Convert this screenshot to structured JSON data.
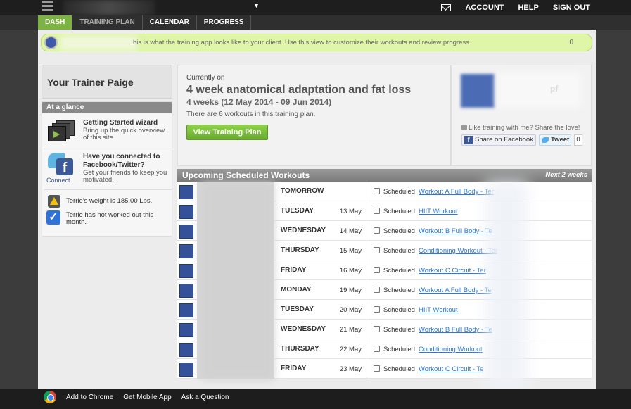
{
  "topbar": {
    "account": "ACCOUNT",
    "help": "HELP",
    "signout": "SIGN OUT",
    "dropdown_arrow": "▼"
  },
  "tabs": [
    "DASH",
    "TRAINING PLAN",
    "CALENDAR",
    "PROGRESS"
  ],
  "banner": {
    "text": "his is what the training app looks like to your client. Use this view to customize their workouts and review progress.",
    "count": "0"
  },
  "trainer": {
    "name": "Your Trainer Paige"
  },
  "glance": {
    "heading": "At a glance",
    "wizard_title": "Getting Started wizard",
    "wizard_desc": "Bring up the quick overview of this site",
    "social_title": "Have you connected to Facebook/Twitter?",
    "social_desc": "Get your friends to keep you motivated.",
    "connect_label": "Connect",
    "weight_text": "Terrie's weight is 185.00 Lbs.",
    "workout_text": "Terrie has not worked out this month."
  },
  "plan": {
    "label": "Currently on",
    "title": "4 week anatomical adaptation and fat loss",
    "dates": "4 weeks (12 May 2014 - 09 Jun 2014)",
    "count": "There are 6 workouts in this training plan.",
    "button": "View Training Plan"
  },
  "share": {
    "name_fragment": "pf",
    "line": "Like training with me? Share the love!",
    "fb_label": "Share on Facebook",
    "tweet_label": "Tweet",
    "tweet_count": "0"
  },
  "workouts": {
    "heading": "Upcoming Scheduled Workouts",
    "next": "Next 2 weeks",
    "rows": [
      {
        "day": "TOMORROW",
        "date": "",
        "status": "Scheduled",
        "link": "Workout A Full Body - Ter"
      },
      {
        "day": "TUESDAY",
        "date": "13 May",
        "status": "Scheduled",
        "link": "HIIT Workout"
      },
      {
        "day": "WEDNESDAY",
        "date": "14 May",
        "status": "Scheduled",
        "link": "Workout B Full Body - Te"
      },
      {
        "day": "THURSDAY",
        "date": "15 May",
        "status": "Scheduled",
        "link": "Conditioning Workout - Ter"
      },
      {
        "day": "FRIDAY",
        "date": "16 May",
        "status": "Scheduled",
        "link": "Workout C Circuit - Ter"
      },
      {
        "day": "MONDAY",
        "date": "19 May",
        "status": "Scheduled",
        "link": "Workout A Full Body - Te"
      },
      {
        "day": "TUESDAY",
        "date": "20 May",
        "status": "Scheduled",
        "link": "HIIT Workout"
      },
      {
        "day": "WEDNESDAY",
        "date": "21 May",
        "status": "Scheduled",
        "link": "Workout B Full Body - Te"
      },
      {
        "day": "THURSDAY",
        "date": "22 May",
        "status": "Scheduled",
        "link": "Conditioning Workout"
      },
      {
        "day": "FRIDAY",
        "date": "23 May",
        "status": "Scheduled",
        "link": "Workout C Circuit - Te"
      }
    ]
  },
  "footer": {
    "chrome": "Add to Chrome",
    "mobile": "Get Mobile App",
    "question": "Ask a Question"
  },
  "colors": {
    "accent": "#7cb342",
    "link": "#2a7ad3",
    "banner": "#dff5a8"
  }
}
